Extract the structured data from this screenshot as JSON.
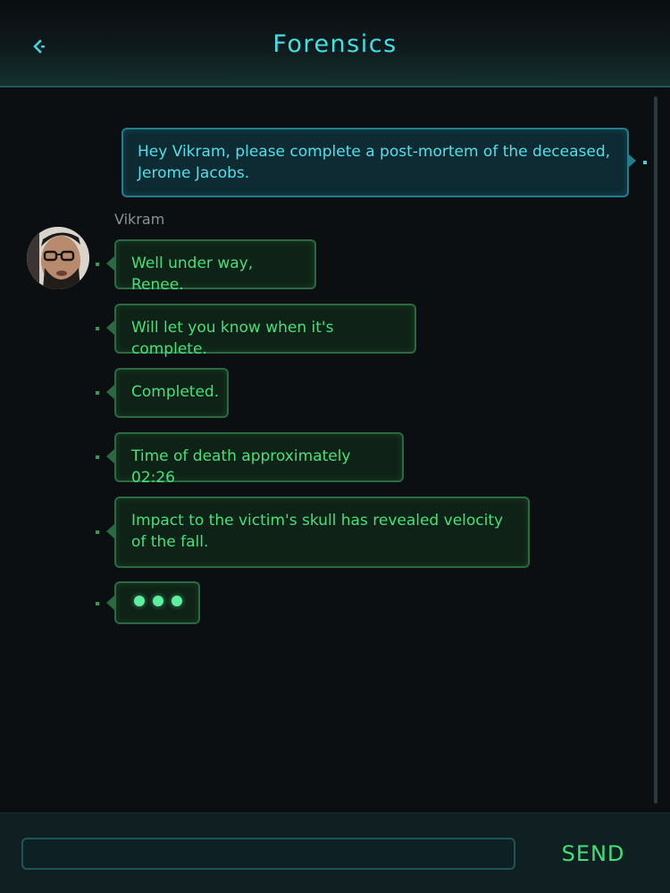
{
  "header": {
    "title": "Forensics",
    "back_icon": "chevron-left-icon"
  },
  "thread": {
    "outgoing": [
      {
        "text": "Hey Vikram, please complete a post-mortem of the deceased, Jerome Jacobs."
      }
    ],
    "sender_name": "Vikram",
    "incoming": [
      {
        "text": "Well under way, Renee."
      },
      {
        "text": "Will let you know when it's complete."
      },
      {
        "text": "Completed."
      },
      {
        "text": "Time of death approximately 02:26"
      },
      {
        "text": "Impact to the victim's skull has revealed velocity of the fall."
      }
    ],
    "typing_indicator": true
  },
  "composer": {
    "input_value": "",
    "send_label": "SEND"
  },
  "colors": {
    "accent_cyan": "#41e0e4",
    "accent_green": "#44e07a",
    "background": "#0b0f12"
  }
}
